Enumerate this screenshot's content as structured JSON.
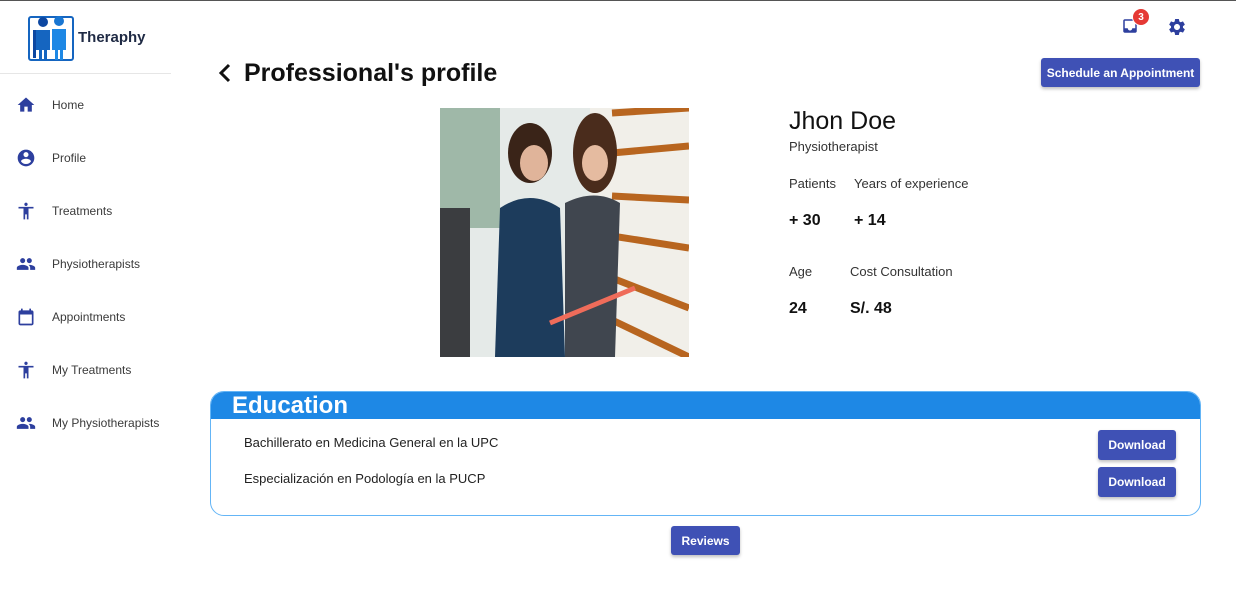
{
  "app": {
    "name": "Theraphy"
  },
  "sidebar": {
    "items": [
      {
        "label": "Home",
        "icon": "home-icon"
      },
      {
        "label": "Profile",
        "icon": "account-circle-icon"
      },
      {
        "label": "Treatments",
        "icon": "accessibility-icon"
      },
      {
        "label": "Physiotherapists",
        "icon": "people-icon"
      },
      {
        "label": "Appointments",
        "icon": "calendar-icon"
      },
      {
        "label": "My Treatments",
        "icon": "accessibility-icon"
      },
      {
        "label": "My Physiotherapists",
        "icon": "people-icon"
      }
    ]
  },
  "header": {
    "notification_count": "3",
    "notification_icon": "inbox-icon",
    "settings_icon": "gear-icon"
  },
  "page": {
    "title": "Professional's profile",
    "schedule_label": "Schedule an Appointment"
  },
  "profile": {
    "name": "Jhon Doe",
    "role": "Physiotherapist",
    "patients_label": "Patients",
    "patients_value": "+ 30",
    "experience_label": "Years of experience",
    "experience_value": "+ 14",
    "age_label": "Age",
    "age_value": "24",
    "cost_label": "Cost Consultation",
    "cost_value": "S/. 48"
  },
  "education": {
    "title": "Education",
    "items": [
      {
        "label": "Bachillerato en Medicina General en la UPC",
        "button": "Download"
      },
      {
        "label": "Especialización en Podología en la PUCP",
        "button": "Download"
      }
    ]
  },
  "reviews_label": "Reviews",
  "colors": {
    "primary": "#3f51b5",
    "education_header": "#1e88e5",
    "badge": "#e53935"
  }
}
